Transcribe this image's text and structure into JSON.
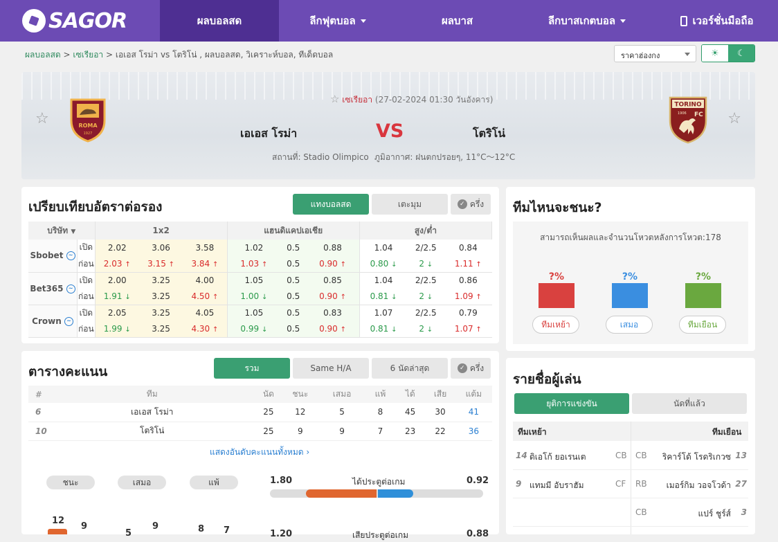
{
  "nav": {
    "logo": "SAGOR",
    "items": [
      {
        "label": "ผลบอลสด",
        "active": true,
        "caret": false
      },
      {
        "label": "ลีกฟุตบอล",
        "active": false,
        "caret": true
      },
      {
        "label": "ผลบาส",
        "active": false,
        "caret": false
      },
      {
        "label": "ลีกบาสเกตบอล",
        "active": false,
        "caret": true
      },
      {
        "label": "เวอร์ชั่นมือถือ",
        "active": false,
        "caret": false
      }
    ]
  },
  "breadcrumb": {
    "home": "ผลบอลสด",
    "league": "เซเรียอา",
    "rest": "เอเอส โรม่า vs  โตริโน่ ,  ผลบอลสด,  วิเคราะห์บอล,  ทีเด็ดบอล"
  },
  "price_select": "ราคาฮ่องกง",
  "match": {
    "league": "เซเรียอา",
    "datetime": "(27-02-2024 01:30 วันอังคาร)",
    "home": "เอเอส โรม่า",
    "away": "โตริโน่",
    "vs": "VS",
    "venue": "สถานที่: Stadio Olimpico",
    "weather": "ภูมิอากาศ: ฝนตกปรอยๆ, 11°C～12°C",
    "away_crest_text": "TORINO",
    "away_crest_fc": "FC",
    "away_crest_year": "1906",
    "home_crest_text": "ROMA",
    "home_crest_year": "1927"
  },
  "odds": {
    "title": "เปรียบเทียบอัตราต่อรอง",
    "tabs": [
      "แทงบอลสด",
      "เตะมุม"
    ],
    "half": "ครึ่ง",
    "headers": {
      "company": "บริษัท",
      "h1x2": "1x2",
      "hcap": "แฮนดิแคปเอเชีย",
      "ou": "สูง/ต่ำ"
    },
    "labels": {
      "open": "เปิด",
      "before": "ก่อน"
    },
    "rows": [
      {
        "name": "Sbobet",
        "open": [
          "2.02",
          "3.06",
          "3.58",
          "1.02",
          "0.5",
          "0.88",
          "1.04",
          "2/2.5",
          "0.84"
        ],
        "before": [
          "2.03",
          "3.15",
          "3.84",
          "1.03",
          "0.5",
          "0.90",
          "0.80",
          "2",
          "1.11"
        ],
        "dir": [
          "u",
          "u",
          "u",
          "u",
          "",
          "u",
          "d",
          "d",
          "u"
        ]
      },
      {
        "name": "Bet365",
        "open": [
          "2.00",
          "3.25",
          "4.00",
          "1.05",
          "0.5",
          "0.85",
          "1.04",
          "2/2.5",
          "0.86"
        ],
        "before": [
          "1.91",
          "3.25",
          "4.50",
          "1.00",
          "0.5",
          "0.90",
          "0.81",
          "2",
          "1.09"
        ],
        "dir": [
          "d",
          "",
          "u",
          "d",
          "",
          "u",
          "d",
          "d",
          "u"
        ]
      },
      {
        "name": "Crown",
        "open": [
          "2.05",
          "3.25",
          "4.05",
          "1.05",
          "0.5",
          "0.83",
          "1.07",
          "2/2.5",
          "0.79"
        ],
        "before": [
          "1.99",
          "3.25",
          "4.30",
          "0.99",
          "0.5",
          "0.90",
          "0.81",
          "2",
          "1.07"
        ],
        "dir": [
          "d",
          "",
          "u",
          "d",
          "",
          "u",
          "d",
          "d",
          "u"
        ]
      }
    ]
  },
  "standings": {
    "title": "ตารางคะแนน",
    "tabs": [
      "รวม",
      "Same H/A",
      "6 นัดล่าสุด"
    ],
    "half": "ครึ่ง",
    "headers": [
      "#",
      "ทีม",
      "นัด",
      "ชนะ",
      "เสมอ",
      "แพ้",
      "ได้",
      "เสีย",
      "แต้ม"
    ],
    "rows": [
      [
        "6",
        "เอเอส โรม่า",
        "25",
        "12",
        "5",
        "8",
        "45",
        "30",
        "41"
      ],
      [
        "10",
        "โตริโน่",
        "25",
        "9",
        "9",
        "7",
        "23",
        "22",
        "36"
      ]
    ],
    "show_all": "แสดงอันดับคะแนนทั้งหมด"
  },
  "stats": {
    "pills": [
      "ชนะ",
      "เสมอ",
      "แพ้"
    ],
    "goals_label": "ได้ประตูต่อเกม",
    "goals_home": "1.80",
    "goals_away": "0.92",
    "goals_home_ratio": 0.66,
    "chart_nums": [
      "12",
      "9",
      "5",
      "9",
      "8",
      "7"
    ],
    "next_left": "1.20",
    "next_label": "เสียประตูต่อเกม",
    "next_right": "0.88"
  },
  "vote": {
    "title": "ทีมไหนจะชนะ?",
    "note": "สามารถเห็นผลและจำนวนโหวตหลังการโหวต:178",
    "items": [
      {
        "pct": "?%",
        "label": "ทีมเหย้า",
        "color": "#d9413f"
      },
      {
        "pct": "?%",
        "label": "เสมอ",
        "color": "#3a8ee0"
      },
      {
        "pct": "?%",
        "label": "ทีมเยือน",
        "color": "#6aa83f"
      }
    ]
  },
  "players": {
    "title": "รายชื่อผู้เล่น",
    "tabs": [
      "ยุติการแข่งขัน",
      "นัดที่แล้ว"
    ],
    "home_h": "ทีมเหย้า",
    "away_h": "ทีมเยือน",
    "home": [
      {
        "no": "14",
        "name": "ดิเอโก้ ยอเรนเต",
        "pos": "CB"
      },
      {
        "no": "9",
        "name": "แทมมี อับราฮัม",
        "pos": "CF"
      }
    ],
    "away": [
      {
        "no": "13",
        "name": "ริคาร์โด้ โรดริเกวซ",
        "pos": "CB"
      },
      {
        "no": "27",
        "name": "เมอร์กิม วอจโวด้า",
        "pos": "RB"
      },
      {
        "no": "3",
        "name": "แปร์ ชูร์ส์",
        "pos": "CB"
      }
    ]
  },
  "colors": {
    "brand": "#6c4bb4",
    "accent": "#3a9f72",
    "vs": "#d9363e"
  }
}
